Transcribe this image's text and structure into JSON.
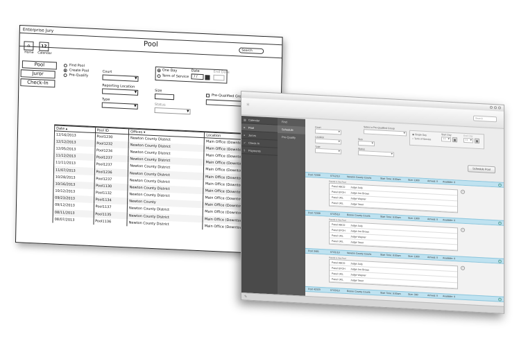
{
  "wireframe": {
    "app_title": "Enterprise Jury",
    "page_title": "Pool",
    "search_placeholder": "Search",
    "calendar_icon_number": "12",
    "icons": [
      {
        "name": "home-icon",
        "label": "Home"
      },
      {
        "name": "calendar-icon",
        "label": "Calendar"
      }
    ],
    "nav": [
      "Pool",
      "Juror",
      "Check-In"
    ],
    "radios_mode": [
      "Find Pool",
      "Create Pool",
      "Pre-Qualify"
    ],
    "mode_selected": 1,
    "form": {
      "court_label": "Court",
      "reporting_location_label": "Reporting Location",
      "type_label": "Type",
      "size_label": "Size",
      "status_label": "Status",
      "one_day": "One Day",
      "term_of_service": "Term of Service",
      "date_label": "Date",
      "date_value": "/ /",
      "end_date_label": "End Date",
      "prequalified_label": "Pre-Qualified Group"
    },
    "table": {
      "headers": [
        "Date",
        "Pool ID",
        "Offices",
        "Location"
      ],
      "rows": [
        [
          "12/16/2013",
          "Pool1230",
          "Newton County District",
          "Main Office (Downtown)"
        ],
        [
          "12/12/2013",
          "Pool1232",
          "Newton County District",
          "Main Office (Downtown)"
        ],
        [
          "12/05/2013",
          "Pool1234",
          "Newton County District",
          "Main Office (Downtown)"
        ],
        [
          "11/12/2013",
          "Pool1237",
          "Newton County District",
          "Main Office (Downtown)"
        ],
        [
          "11/11/2013",
          "Pool1237",
          "Newton County District",
          "Main Office (Downtown)"
        ],
        [
          "11/07/2013",
          "Pool1236",
          "Newton County District",
          "Main Office (Downtown)"
        ],
        [
          "10/28/2013",
          "Pool1237",
          "Newton County District",
          "Main Office (Downtown)"
        ],
        [
          "10/16/2013",
          "Pool1130",
          "Newton County District",
          "Main Office (Downtown)"
        ],
        [
          "10/12/2013",
          "Pool1132",
          "Newton County District",
          "Main Office (Downtown)"
        ],
        [
          "09/23/2013",
          "Pool1134",
          "Newton County",
          "Main Office (Downtown)"
        ],
        [
          "09/12/2013",
          "Pool1137",
          "Newton County District",
          "Main Office (Downtown)"
        ],
        [
          "08/11/2013",
          "Pool1135",
          "Newton County District",
          "Main Office (Downtown)"
        ],
        [
          "08/07/2013",
          "Pool1136",
          "Newton County District",
          "Main Office (Downtown)"
        ]
      ]
    }
  },
  "app": {
    "search_placeholder": "Search",
    "sidebar": [
      "Calendar",
      "Pool",
      "Jurors",
      "Check-In",
      "Payments"
    ],
    "sidebar_active": 1,
    "subnav": [
      "Find",
      "Schedule",
      "Pre-Qualify"
    ],
    "subnav_active": 1,
    "form": {
      "court_label": "Court",
      "prequalified_label": "Select a Pre-Qualified Group",
      "location_label": "Location",
      "size_label": "Size",
      "type_label": "Type",
      "status_label": "Status",
      "single_day": "Single Day",
      "term_of_service": "Term of Service",
      "start_day_label": "Start Day",
      "end_day_label": "End Day",
      "date_value": "/ /",
      "schedule_button": "Schedule Pool"
    },
    "panel_header": "Panels in this Pool",
    "pools": [
      {
        "id": "Pool 72308",
        "date": "07/12/13",
        "court": "Newton County Courts",
        "start": "Start Time: 8:00am",
        "size": "Size: 1000",
        "arrived": "Arrived: 0",
        "available": "Available: 0",
        "panels": [
          [
            "Panel ABCD",
            "Judge Judy"
          ],
          [
            "Panel EFGH",
            "Judge Joe Brown"
          ],
          [
            "Panel IJKL",
            "Judge Wapner"
          ],
          [
            "Panel IJKL",
            "Judge Tauer"
          ]
        ]
      },
      {
        "id": "Pool 72308",
        "date": "07/25/13",
        "court": "Boone County Courts",
        "start": "Start Time: 9:00am",
        "size": "Size: 1000",
        "arrived": "Arrived: 0",
        "available": "Available: 0",
        "panels": [
          [
            "Panel ABCD",
            "Judge Judy"
          ],
          [
            "Panel EFGH",
            "Judge Joe Brown"
          ],
          [
            "Panel IJKL",
            "Judge Wapner"
          ],
          [
            "Panel IJKL",
            "Judge Tauer"
          ]
        ]
      },
      {
        "id": "Pool 3481",
        "date": "07/21/13",
        "court": "Newton County Courts",
        "start": "Start Time: 8:00am",
        "size": "Size: 1000",
        "arrived": "Arrived: 0",
        "available": "Available: 0",
        "panels": [
          [
            "Panel ABCD",
            "Judge Judy"
          ],
          [
            "Panel EFGH",
            "Judge Joe Brown"
          ],
          [
            "Panel IJKL",
            "Judge Wapner"
          ],
          [
            "Panel IJKL",
            "Judge Tauer"
          ]
        ]
      },
      {
        "id": "Pool 42323",
        "date": "07/23/13",
        "court": "Boone County Courts",
        "start": "Start Time: 9:00am",
        "size": "Size: 300",
        "arrived": "Arrived: 0",
        "available": "Available: 0",
        "panels": []
      }
    ]
  }
}
